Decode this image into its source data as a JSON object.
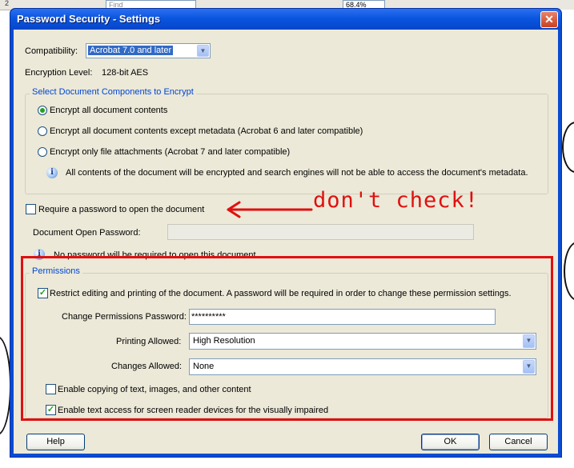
{
  "background": {
    "find_placeholder": "Find",
    "zoom_value": "68.4%",
    "page_number": "2"
  },
  "dialog": {
    "title": "Password Security - Settings",
    "close_glyph": "✕"
  },
  "compatibility": {
    "label": "Compatibility:",
    "value": "Acrobat 7.0 and later"
  },
  "encryption": {
    "label": "Encryption  Level:",
    "value": "128-bit AES"
  },
  "components": {
    "group_title": "Select Document Components to Encrypt",
    "options": [
      {
        "label": "Encrypt all document contents",
        "selected": true
      },
      {
        "label": "Encrypt all document contents except metadata (Acrobat 6 and later compatible)",
        "selected": false
      },
      {
        "label": "Encrypt only file attachments (Acrobat 7 and later compatible)",
        "selected": false
      }
    ],
    "info": "All contents of the document will be encrypted and search engines will not be able to access the document's metadata."
  },
  "open_password": {
    "require_label": "Require a password to open the document",
    "require_checked": false,
    "field_label": "Document Open Password:",
    "field_value": "",
    "info": "No password will be required to open this document."
  },
  "annotation": {
    "text": "don't check!",
    "color": "#e01010"
  },
  "permissions": {
    "group_title": "Permissions",
    "restrict_label": "Restrict editing and printing of the document. A password will be required in order to change these permission settings.",
    "restrict_checked": true,
    "change_password_label": "Change Permissions Password:",
    "change_password_value": "**********",
    "printing_label": "Printing Allowed:",
    "printing_value": "High Resolution",
    "changes_label": "Changes Allowed:",
    "changes_value": "None",
    "copy_label": "Enable copying of text, images, and other content",
    "copy_checked": false,
    "screen_reader_label": "Enable text access for screen reader devices for the visually impaired",
    "screen_reader_checked": true
  },
  "buttons": {
    "help": "Help",
    "ok": "OK",
    "cancel": "Cancel"
  },
  "icons": {
    "info": "info-icon",
    "dropdown": "chevron-down-icon",
    "close": "close-icon",
    "arrow": "left-arrow-annotation-icon"
  }
}
